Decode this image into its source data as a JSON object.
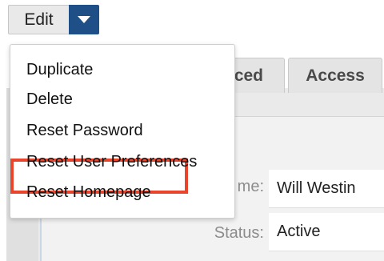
{
  "toolbar": {
    "edit_label": "Edit",
    "dropdown_icon": "caret-down-icon",
    "accent_color": "#1e4f86"
  },
  "tabs": [
    {
      "label": "ced"
    },
    {
      "label": "Access"
    }
  ],
  "menu": {
    "items": [
      {
        "label": "Duplicate"
      },
      {
        "label": "Delete"
      },
      {
        "label": "Reset Password",
        "highlighted": true
      },
      {
        "label": "Reset User Preferences"
      },
      {
        "label": "Reset Homepage"
      }
    ],
    "highlight_color": "#e8452c"
  },
  "form": {
    "name_label": "me:",
    "name_value": "Will Westin",
    "status_label": "Status:",
    "status_value": "Active"
  }
}
